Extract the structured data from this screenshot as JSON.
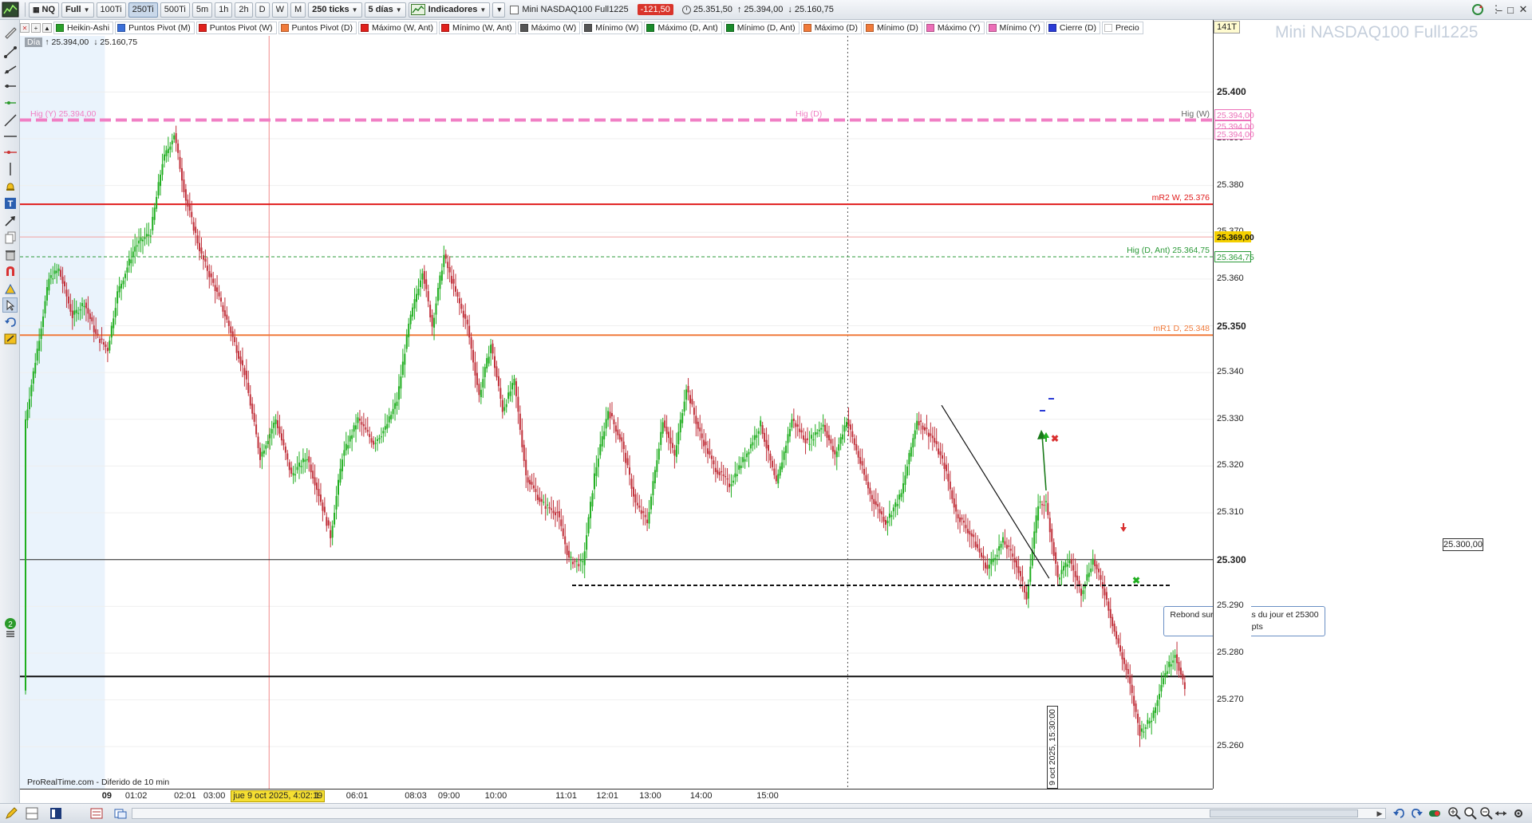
{
  "toolbar": {
    "symbol": "NQ",
    "style": "Full",
    "interval_buttons": [
      "100Ti",
      "250Ti",
      "500Ti",
      "5m",
      "1h",
      "2h",
      "D",
      "W",
      "M"
    ],
    "active_interval": "250Ti",
    "units": "250 ticks",
    "range": "5 días",
    "indicators": "Indicadores",
    "instrument": "Mini NASDAQ100 Full1225",
    "change": "-121,50",
    "ohlc": [
      "25.351,50",
      "↑ 25.394,00",
      "↓ 25.160,75"
    ],
    "colors": {
      "change_bg": "#d9342b"
    }
  },
  "indicators": [
    {
      "label": "Heikin-Ashi",
      "color": "#2aa02a"
    },
    {
      "label": "Puntos Pivot (M)",
      "color": "#3b6fd8"
    },
    {
      "label": "Puntos Pivot (W)",
      "color": "#e0201b"
    },
    {
      "label": "Puntos Pivot (D)",
      "color": "#f07a3a"
    },
    {
      "label": "Máximo (W, Ant)",
      "color": "#e0201b"
    },
    {
      "label": "Mínimo (W, Ant)",
      "color": "#e0201b"
    },
    {
      "label": "Máximo (W)",
      "color": "#555555"
    },
    {
      "label": "Mínimo (W)",
      "color": "#555555"
    },
    {
      "label": "Máximo (D, Ant)",
      "color": "#1a8a2a"
    },
    {
      "label": "Mínimo (D, Ant)",
      "color": "#1a8a2a"
    },
    {
      "label": "Máximo (D)",
      "color": "#f07a3a"
    },
    {
      "label": "Mínimo (D)",
      "color": "#f07a3a"
    },
    {
      "label": "Máximo (Y)",
      "color": "#ec6fb8"
    },
    {
      "label": "Mínimo (Y)",
      "color": "#ec6fb8"
    },
    {
      "label": "Cierre (D)",
      "color": "#2a3bd6"
    },
    {
      "label": "Precio",
      "color": "#ffffff"
    }
  ],
  "chart": {
    "watermark": "Mini NASDAQ100 Full1225",
    "tick_count": "141T",
    "day_label": "Día",
    "day_high": "↑ 25.394,00",
    "day_low": "↓ 25.160,75",
    "source": "ProRealTime.com - Diferido de 10 min",
    "colors": {
      "up": "#1fae1f",
      "down": "#c0303a"
    }
  },
  "chart_data": {
    "type": "candlestick",
    "y_ticks": [
      25260,
      25270,
      25280,
      25290,
      25300,
      25310,
      25320,
      25330,
      25340,
      25350,
      25360,
      25370,
      25380,
      25390,
      25400
    ],
    "y_tick_labels": [
      "25.260",
      "25.270",
      "25.280",
      "25.290",
      "25.300",
      "25.310",
      "25.320",
      "25.330",
      "25.340",
      "25.350",
      "25.360",
      "25.370",
      "25.380",
      "25.390",
      "25.400"
    ],
    "ylim": [
      25251,
      25412
    ],
    "x_labels": [
      {
        "label": "09",
        "bold": true,
        "bar": 42
      },
      {
        "label": "01:02",
        "bar": 57
      },
      {
        "label": "02:01",
        "bar": 82
      },
      {
        "label": "03:00",
        "bar": 97
      },
      {
        "label": "06:01",
        "bar": 170
      },
      {
        "label": "08:03",
        "bar": 200
      },
      {
        "label": "09:00",
        "bar": 217
      },
      {
        "label": "10:00",
        "bar": 241
      },
      {
        "label": "11:01",
        "bar": 277
      },
      {
        "label": "12:01",
        "bar": 298
      },
      {
        "label": "13:00",
        "bar": 320
      },
      {
        "label": "14:00",
        "bar": 346
      },
      {
        "label": "15:00",
        "bar": 380
      }
    ],
    "time_cursor": "jue 9 oct 2025, 4:02:19",
    "time_cursor_suffix": "1",
    "time_cursor_bar": 125,
    "vertical_cursor_label": "9 oct 2025, 15:30:00",
    "vertical_cursor_bar": 421,
    "waypoints": [
      [
        0,
        25330
      ],
      [
        6,
        25345
      ],
      [
        12,
        25360
      ],
      [
        17,
        25362
      ],
      [
        24,
        25352
      ],
      [
        30,
        25355
      ],
      [
        36,
        25348
      ],
      [
        42,
        25345
      ],
      [
        47,
        25357
      ],
      [
        56,
        25367
      ],
      [
        64,
        25370
      ],
      [
        70,
        25385
      ],
      [
        76,
        25391
      ],
      [
        82,
        25377
      ],
      [
        90,
        25365
      ],
      [
        97,
        25358
      ],
      [
        104,
        25350
      ],
      [
        112,
        25340
      ],
      [
        120,
        25322
      ],
      [
        128,
        25330
      ],
      [
        136,
        25318
      ],
      [
        144,
        25322
      ],
      [
        150,
        25314
      ],
      [
        156,
        25305
      ],
      [
        162,
        25322
      ],
      [
        170,
        25330
      ],
      [
        178,
        25325
      ],
      [
        184,
        25328
      ],
      [
        190,
        25334
      ],
      [
        196,
        25350
      ],
      [
        203,
        25362
      ],
      [
        208,
        25350
      ],
      [
        214,
        25365
      ],
      [
        220,
        25357
      ],
      [
        226,
        25350
      ],
      [
        232,
        25335
      ],
      [
        238,
        25346
      ],
      [
        244,
        25332
      ],
      [
        250,
        25338
      ],
      [
        256,
        25318
      ],
      [
        264,
        25312
      ],
      [
        272,
        25310
      ],
      [
        278,
        25300
      ],
      [
        285,
        25299
      ],
      [
        291,
        25318
      ],
      [
        298,
        25332
      ],
      [
        305,
        25325
      ],
      [
        312,
        25312
      ],
      [
        318,
        25308
      ],
      [
        326,
        25330
      ],
      [
        332,
        25322
      ],
      [
        338,
        25337
      ],
      [
        344,
        25328
      ],
      [
        352,
        25320
      ],
      [
        360,
        25316
      ],
      [
        368,
        25322
      ],
      [
        376,
        25329
      ],
      [
        384,
        25316
      ],
      [
        392,
        25330
      ],
      [
        400,
        25325
      ],
      [
        408,
        25329
      ],
      [
        414,
        25322
      ],
      [
        420,
        25330
      ],
      [
        426,
        25322
      ],
      [
        432,
        25314
      ],
      [
        440,
        25308
      ],
      [
        448,
        25314
      ],
      [
        456,
        25330
      ],
      [
        464,
        25326
      ],
      [
        470,
        25320
      ],
      [
        476,
        25310
      ],
      [
        484,
        25305
      ],
      [
        492,
        25298
      ],
      [
        500,
        25304
      ],
      [
        506,
        25300
      ],
      [
        512,
        25292
      ],
      [
        518,
        25312
      ],
      [
        522,
        25312
      ],
      [
        528,
        25296
      ],
      [
        534,
        25300
      ],
      [
        540,
        25293
      ],
      [
        546,
        25300
      ],
      [
        552,
        25293
      ],
      [
        558,
        25283
      ],
      [
        564,
        25275
      ],
      [
        570,
        25263
      ],
      [
        576,
        25266
      ],
      [
        582,
        25275
      ],
      [
        588,
        25280
      ],
      [
        593,
        25272
      ]
    ],
    "horizontal_lines": [
      {
        "price": 25394,
        "color": "#f07fc4",
        "style": "thick-dash",
        "left_label": "Hig (Y) 25.394,00",
        "mid_label": "Hig (D)",
        "right_label": "Hig (W)"
      },
      {
        "price": 25376,
        "color": "#e01b1b",
        "style": "solid",
        "right_label": "mR2 W, 25.376"
      },
      {
        "price": 25369,
        "color": "#f2a0a0",
        "style": "thin"
      },
      {
        "price": 25364.75,
        "color": "#2b9a38",
        "style": "dash",
        "right_label": "Hig (D, Ant) 25.364,75"
      },
      {
        "price": 25348,
        "color": "#f07a3a",
        "style": "solid",
        "right_label": "mR1 D, 25.348"
      },
      {
        "price": 25300,
        "color": "#222222",
        "style": "thin-solid"
      },
      {
        "price": 25275,
        "color": "#111111",
        "style": "solid-thick"
      }
    ],
    "price_tags": [
      {
        "label": "25.394,00",
        "price": 25395.2,
        "color": "#ec6fb8"
      },
      {
        "label": "25.394,00",
        "price": 25392.8,
        "color": "#ec6fb8"
      },
      {
        "label": "25.394,00",
        "price": 25391.0,
        "color": "#ec6fb8"
      },
      {
        "label": "25.369,00",
        "price": 25369,
        "color": "#f5d000",
        "bold": true
      },
      {
        "label": "25.364,75",
        "price": 25364.75,
        "color": "#2b9a38"
      }
    ]
  },
  "annotations": {
    "rebound_text_1": "Rebond sur le plus bas du jour et 25300",
    "rebound_text_2": "+ 3,75 pts",
    "level_tag": "25.300,00"
  },
  "window": {
    "minimize": "–",
    "restore": "□",
    "close": "✕"
  }
}
